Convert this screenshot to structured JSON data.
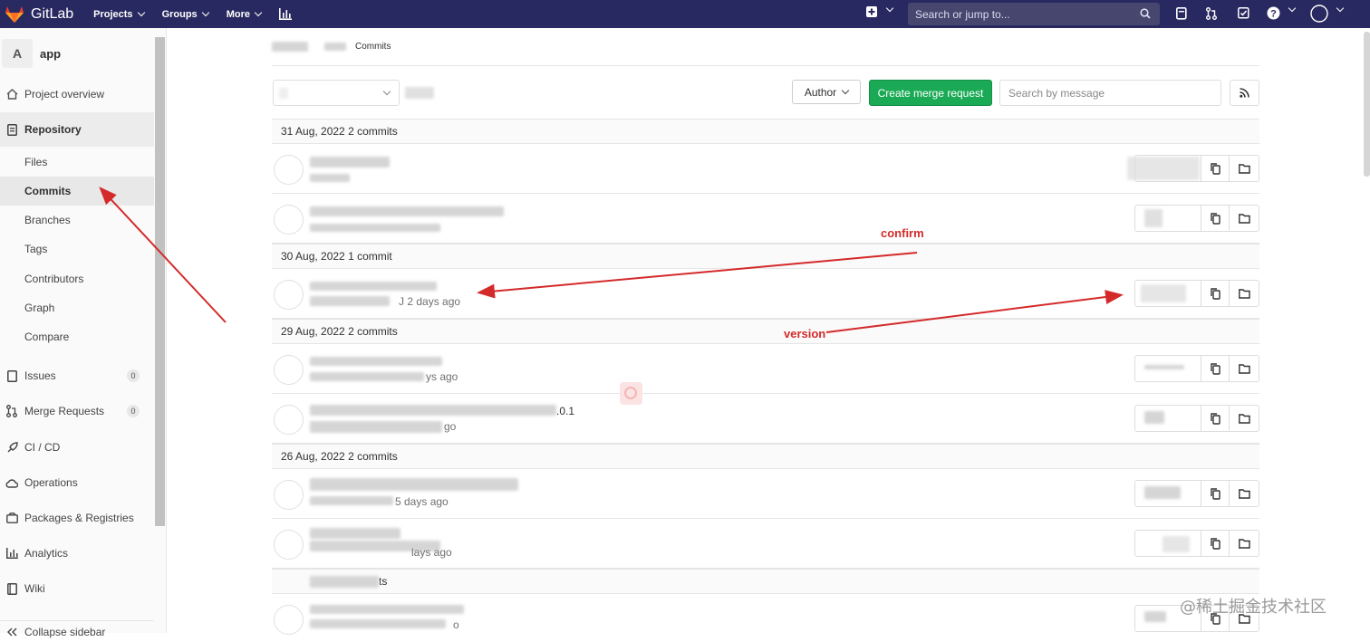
{
  "topbar": {
    "brand": "GitLab",
    "nav": [
      {
        "label": "Projects"
      },
      {
        "label": "Groups"
      },
      {
        "label": "More"
      }
    ],
    "search_placeholder": "Search or jump to..."
  },
  "sidebar": {
    "project_avatar": "A",
    "project_name": "app",
    "items": {
      "overview": "Project overview",
      "repository": "Repository",
      "files": "Files",
      "commits": "Commits",
      "branches": "Branches",
      "tags": "Tags",
      "contributors": "Contributors",
      "graph": "Graph",
      "compare": "Compare",
      "issues": "Issues",
      "issues_count": "0",
      "merge_requests": "Merge Requests",
      "merge_requests_count": "0",
      "cicd": "CI / CD",
      "operations": "Operations",
      "packages": "Packages & Registries",
      "analytics": "Analytics",
      "wiki": "Wiki",
      "collapse": "Collapse sidebar"
    }
  },
  "breadcrumb": {
    "current": "Commits"
  },
  "toolbar": {
    "author_label": "Author",
    "merge_request_label": "Create merge request",
    "search_placeholder": "Search by message"
  },
  "days": [
    {
      "label": "31 Aug, 2022 2 commits"
    },
    {
      "label": "30 Aug, 2022 1 commit"
    },
    {
      "label": "29 Aug, 2022 2 commits"
    },
    {
      "label": "26 Aug, 2022 2 commits"
    },
    {
      "label": "ts"
    }
  ],
  "commit_meta": {
    "row3": "J 2 days ago",
    "row4": "ys ago",
    "row5_tail": ".0.1",
    "row5": "go",
    "row6": "5 days ago",
    "row7": "lays ago",
    "row8": "o"
  },
  "annotations": {
    "confirm": "confirm",
    "version": "version"
  },
  "watermark": "@稀土掘金技术社区",
  "colors": {
    "navbar": "#292961",
    "primary_button": "#1aaa55",
    "annotation": "#d42a2a"
  }
}
